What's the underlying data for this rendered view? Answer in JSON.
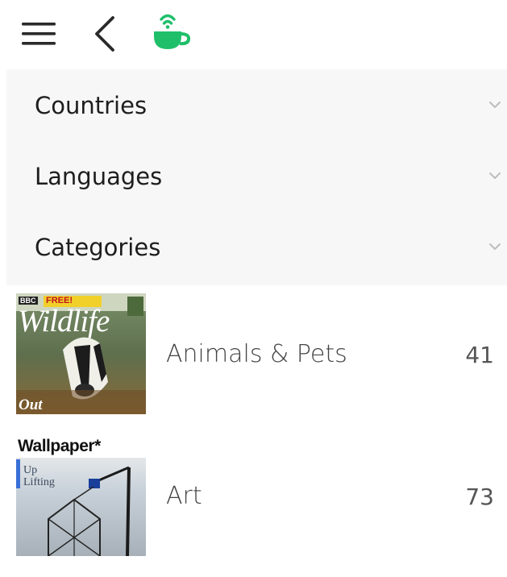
{
  "toolbar": {
    "menu_icon": "hamburger-menu-icon",
    "back_icon": "chevron-left-icon",
    "logo_icon": "coffee-cup-signal-icon",
    "logo_color": "#1fbf6a"
  },
  "filters": [
    {
      "label": "Countries"
    },
    {
      "label": "Languages"
    },
    {
      "label": "Categories"
    }
  ],
  "categories": [
    {
      "name": "Animals & Pets",
      "count": "41",
      "cover": {
        "masthead": "Wildlife",
        "badge": "FREE!",
        "publisher": "BBC",
        "corner_text": "Out"
      }
    },
    {
      "name": "Art",
      "count": "73",
      "cover": {
        "masthead": "Wallpaper*",
        "headline": "Up Lifting"
      }
    }
  ]
}
